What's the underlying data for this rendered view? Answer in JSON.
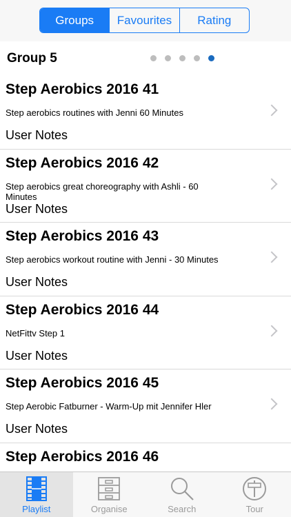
{
  "segments": [
    {
      "label": "Groups",
      "active": true
    },
    {
      "label": "Favourites",
      "active": false
    },
    {
      "label": "Rating",
      "active": false
    }
  ],
  "group": {
    "title": "Group 5",
    "page_count": 5,
    "active_page": 5
  },
  "items": [
    {
      "title": "Step Aerobics 2016 41",
      "description": "Step aerobics routines with Jenni  60 Minutes",
      "notes": "User Notes"
    },
    {
      "title": "Step Aerobics 2016 42",
      "description": "Step aerobics great choreography with Ashli - 60 Minutes",
      "notes": "User Notes"
    },
    {
      "title": "Step Aerobics 2016 43",
      "description": "Step aerobics workout routine with Jenni - 30 Minutes",
      "notes": "User Notes"
    },
    {
      "title": "Step Aerobics 2016 44",
      "description": "NetFittv Step 1",
      "notes": "User Notes"
    },
    {
      "title": "Step Aerobics 2016 45",
      "description": "Step Aerobic Fatburner - Warm-Up mit Jennifer Hler",
      "notes": "User Notes"
    },
    {
      "title": "Step Aerobics 2016 46",
      "description": "",
      "notes": ""
    }
  ],
  "tabs": [
    {
      "label": "Playlist",
      "icon": "film-strip-icon",
      "active": true
    },
    {
      "label": "Organise",
      "icon": "cabinet-icon",
      "active": false
    },
    {
      "label": "Search",
      "icon": "magnifier-icon",
      "active": false
    },
    {
      "label": "Tour",
      "icon": "signpost-icon",
      "active": false
    }
  ],
  "colors": {
    "accent": "#1a7cf5",
    "inactive": "#9a9a9a"
  }
}
